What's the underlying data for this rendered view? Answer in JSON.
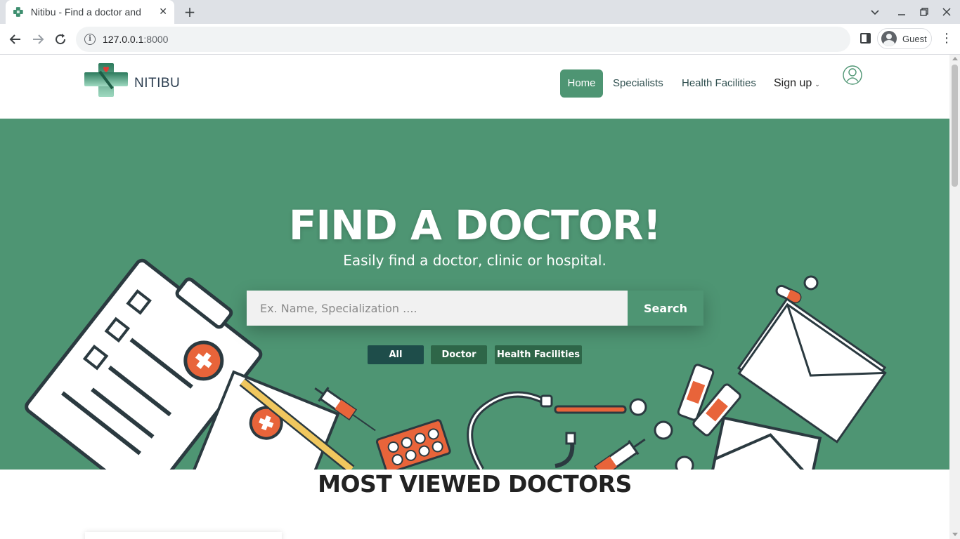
{
  "browser": {
    "tab_title": "Nitibu - Find a doctor and",
    "tab_close": "✕",
    "new_tab": "+",
    "url_host": "127.0.0.1",
    "url_port": ":8000",
    "profile_name": "Guest",
    "icons": [
      "back-icon",
      "forward-icon",
      "reload-icon",
      "info-icon",
      "side-panel-icon",
      "profile-icon",
      "menu-icon"
    ]
  },
  "site": {
    "brand": "NITIBU",
    "nav": {
      "home": "Home",
      "specialists": "Specialists",
      "health_facilities": "Health Facilities",
      "signup": "Sign up"
    },
    "accent_color": "#4e9573"
  },
  "hero": {
    "title": "FIND A DOCTOR!",
    "subtitle": "Easily find a doctor, clinic or hospital.",
    "search_placeholder": "Ex. Name, Specialization ....",
    "search_button": "Search",
    "filters": {
      "all": "All",
      "doctor": "Doctor",
      "health_facilities": "Health Facilities"
    }
  },
  "section": {
    "most_viewed_title": "MOST VIEWED DOCTORS"
  }
}
